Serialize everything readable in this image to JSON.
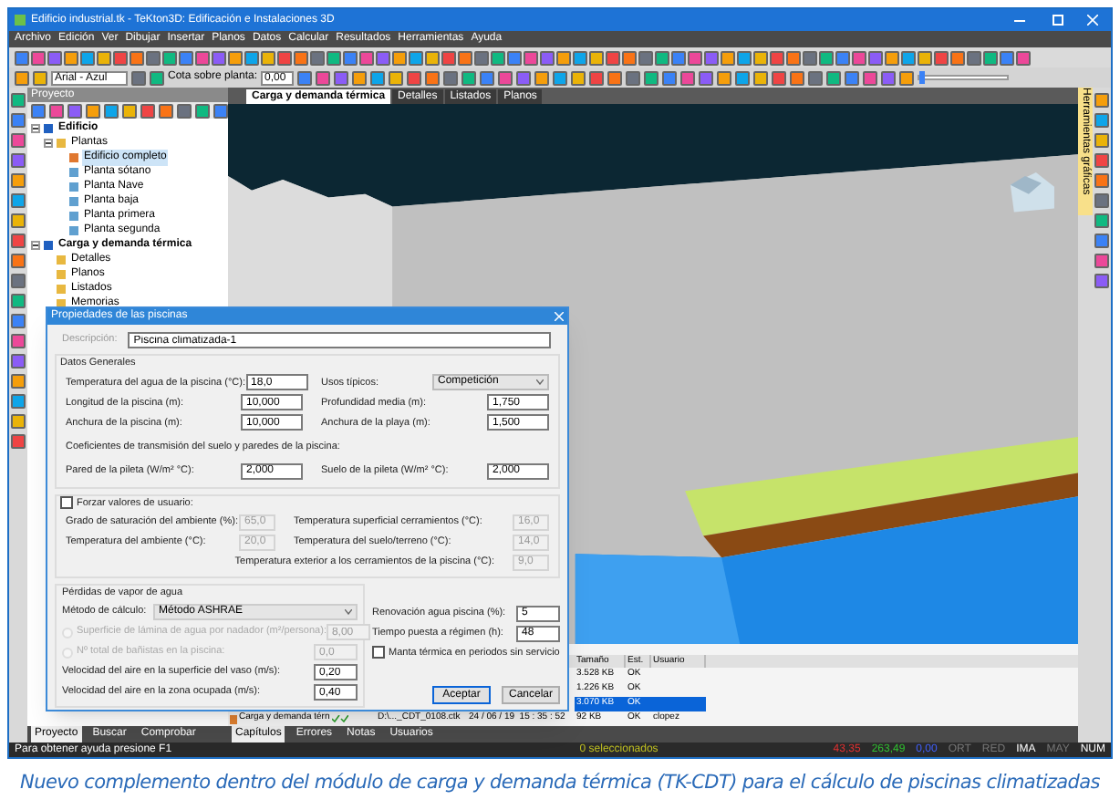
{
  "window": {
    "title": "Edificio industrial.tk - TeKton3D: Edificación e Instalaciones 3D"
  },
  "menu": [
    "Archivo",
    "Edición",
    "Ver",
    "Dibujar",
    "Insertar",
    "Planos",
    "Datos",
    "Calcular",
    "Resultados",
    "Herramientas",
    "Ayuda"
  ],
  "toolbar": {
    "style_select": "Arial - Azul",
    "elevation_label": "Cota sobre planta:",
    "elevation_value": "0,00",
    "zoom_slider": {
      "level": 0.03
    }
  },
  "project_panel": {
    "title": "Proyecto",
    "tree": [
      {
        "label": "Edificio",
        "kind": "root",
        "expanded": true,
        "selected": false,
        "children": [
          {
            "label": "Plantas",
            "kind": "folder",
            "expanded": true,
            "selected": false,
            "children": [
              {
                "label": "Edificio completo",
                "kind": "building",
                "selected": true
              },
              {
                "label": "Planta sótano",
                "kind": "floor",
                "selected": false
              },
              {
                "label": "Planta Nave",
                "kind": "floor",
                "selected": false
              },
              {
                "label": "Planta baja",
                "kind": "floor",
                "selected": false
              },
              {
                "label": "Planta primera",
                "kind": "floor",
                "selected": false
              },
              {
                "label": "Planta segunda",
                "kind": "floor",
                "selected": false
              }
            ]
          }
        ]
      },
      {
        "label": "Carga y demanda térmica",
        "kind": "root",
        "expanded": true,
        "selected": false,
        "children": [
          {
            "label": "Detalles",
            "kind": "folder",
            "selected": false
          },
          {
            "label": "Planos",
            "kind": "folder",
            "selected": false
          },
          {
            "label": "Listados",
            "kind": "folder",
            "selected": false
          },
          {
            "label": "Memorias",
            "kind": "folder",
            "selected": false
          }
        ]
      }
    ]
  },
  "tabs": [
    {
      "label": "Carga y demanda térmica",
      "selected": true
    },
    {
      "label": "Detalles",
      "selected": false
    },
    {
      "label": "Listados",
      "selected": false
    },
    {
      "label": "Planos",
      "selected": false
    }
  ],
  "side_tab": "Herramientas gráficas",
  "file_table": {
    "columns": [
      "Tamaño",
      "Est.",
      "Usuario"
    ],
    "rows": [
      {
        "size": "3.528 KB",
        "status": "OK",
        "selected": false
      },
      {
        "size": "1.226 KB",
        "status": "OK",
        "selected": false
      },
      {
        "size": "3.070 KB",
        "status": "OK",
        "selected": true
      },
      {
        "name": "Carga y demanda térn",
        "file": "D:\\..._CDT_0108.ctk",
        "date": "24 / 06 / 19  15 : 35 : 52",
        "size": "92 KB",
        "status": "OK",
        "user": "clopez",
        "selected": false
      }
    ]
  },
  "left_tabs": [
    {
      "label": "Proyecto",
      "selected": true
    },
    {
      "label": "Buscar",
      "selected": false
    },
    {
      "label": "Comprobar",
      "selected": false
    }
  ],
  "bottom_tabs": [
    {
      "label": "Capítulos",
      "selected": true
    },
    {
      "label": "Errores",
      "selected": false
    },
    {
      "label": "Notas",
      "selected": false
    },
    {
      "label": "Usuarios",
      "selected": false
    }
  ],
  "status_bar": {
    "help": "Para obtener ayuda presione F1",
    "selection": "0 seleccionados",
    "readouts": [
      "43,35",
      "263,49",
      "0,00"
    ],
    "indicators": [
      {
        "label": "ORT",
        "on": false
      },
      {
        "label": "RED",
        "on": false
      },
      {
        "label": "IMA",
        "on": true
      },
      {
        "label": "MAY",
        "on": false
      },
      {
        "label": "NUM",
        "on": true
      }
    ]
  },
  "dialog": {
    "title": "Propiedades de las piscinas",
    "description": {
      "label": "Descripción:",
      "value": "Piscina climatizada-1"
    },
    "general": {
      "title": "Datos Generales",
      "left": [
        {
          "label": "Temperatura del agua de la piscina (°C):",
          "value": "18,0"
        },
        {
          "label": "Longitud de la piscina (m):",
          "value": "10,000"
        },
        {
          "label": "Anchura de la piscina (m):",
          "value": "10,000"
        }
      ],
      "use": {
        "label": "Usos típicos:",
        "value": "Competición"
      },
      "right": [
        {
          "label": "Profundidad media (m):",
          "value": "1,750"
        },
        {
          "label": "Anchura de la playa (m):",
          "value": "1,500"
        }
      ],
      "coef_title": "Coeficientes de transmisión del suelo y paredes de la piscina:",
      "coef": [
        {
          "label": "Pared de la pileta (W/m² °C):",
          "value": "2,000"
        },
        {
          "label": "Suelo de la pileta (W/m² °C):",
          "value": "2,000"
        }
      ]
    },
    "force": {
      "label": "Forzar valores de usuario:",
      "checked": false,
      "left": [
        {
          "label": "Grado de saturación del ambiente  (%):",
          "value": "65,0"
        },
        {
          "label": "Temperatura del ambiente (°C):",
          "value": "20,0"
        }
      ],
      "right": [
        {
          "label": "Temperatura superficial cerramientos (°C):",
          "value": "16,0"
        },
        {
          "label": "Temperatura del  suelo/terreno (°C):",
          "value": "14,0"
        }
      ],
      "exterior": {
        "label": "Temperatura exterior a los cerramientos de la piscina (°C):",
        "value": "9,0"
      }
    },
    "vapor": {
      "title": "Pérdidas de vapor de agua",
      "method": {
        "label": "Método de cálculo:",
        "value": "Método ASHRAE"
      },
      "options": [
        {
          "label": "Superficie de lámina de agua por nadador (m²/persona):",
          "value": "8,00",
          "selected": false,
          "disabled": true
        },
        {
          "label": "Nº total de bañistas en la piscina:",
          "value": "0,0",
          "selected": false,
          "disabled": true
        }
      ],
      "speeds": [
        {
          "label": "Velocidad del aire en la superficie del vaso (m/s):",
          "value": "0,20"
        },
        {
          "label": "Velocidad del aire en la zona ocupada (m/s):",
          "value": "0,40"
        }
      ],
      "renewal": [
        {
          "label": "Renovación agua piscina (%):",
          "value": "5"
        },
        {
          "label": "Tiempo puesta a régimen (h):",
          "value": "48"
        }
      ],
      "blanket": {
        "label": "Manta térmica en periodos sin servicio",
        "checked": false
      }
    },
    "buttons": [
      {
        "label": "Aceptar",
        "default": true
      },
      {
        "label": "Cancelar",
        "default": false
      }
    ]
  },
  "caption": "Nuevo complemento dentro del módulo de carga y demanda térmica (TK-CDT) para el cálculo de piscinas climatizadas"
}
